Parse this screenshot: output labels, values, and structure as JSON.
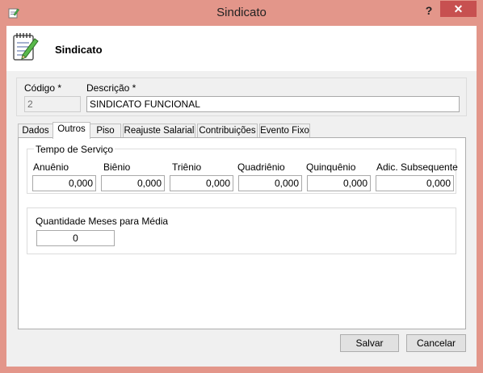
{
  "window": {
    "title": "Sindicato",
    "help_glyph": "?",
    "close_glyph": "✕",
    "title_icon": "notepad-pencil-icon",
    "accent_color": "#e3968a"
  },
  "header": {
    "title": "Sindicato",
    "icon": "notepad-pencil-icon"
  },
  "form": {
    "codigo_label": "Código *",
    "codigo_value": "2",
    "descricao_label": "Descrição *",
    "descricao_value": "SINDICATO FUNCIONAL"
  },
  "tabs": [
    {
      "label": "Dados"
    },
    {
      "label": "Outros",
      "active": true
    },
    {
      "label": "Piso"
    },
    {
      "label": "Reajuste Salarial"
    },
    {
      "label": "Contribuições"
    },
    {
      "label": "Evento Fixo"
    }
  ],
  "tempo_servico": {
    "title": "Tempo de Serviço",
    "fields": [
      {
        "label": "Anuênio",
        "value": "0,000"
      },
      {
        "label": "Biênio",
        "value": "0,000"
      },
      {
        "label": "Triênio",
        "value": "0,000"
      },
      {
        "label": "Quadriênio",
        "value": "0,000"
      },
      {
        "label": "Quinquênio",
        "value": "0,000"
      },
      {
        "label": "Adic. Subsequente",
        "value": "0,000"
      }
    ]
  },
  "media": {
    "label": "Quantidade Meses para Média",
    "value": "0"
  },
  "buttons": {
    "salvar": "Salvar",
    "cancelar": "Cancelar"
  }
}
